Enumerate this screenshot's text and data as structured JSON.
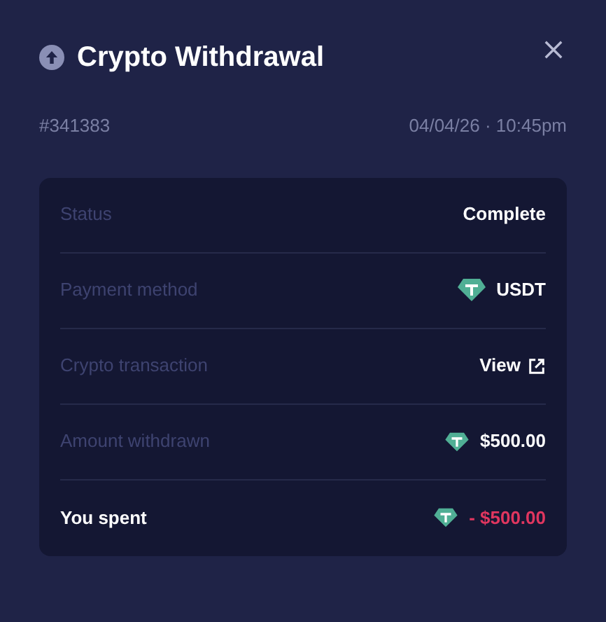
{
  "title": "Crypto Withdrawal",
  "id": "#341383",
  "datetime": "04/04/26 · 10:45pm",
  "rows": [
    {
      "label": "Status",
      "value": "Complete",
      "kind": "text",
      "emphasis": false
    },
    {
      "label": "Payment method",
      "value": "USDT",
      "kind": "token",
      "emphasis": false
    },
    {
      "label": "Crypto transaction",
      "value": "View",
      "kind": "link",
      "emphasis": false
    },
    {
      "label": "Amount withdrawn",
      "value": "$500.00",
      "kind": "token",
      "emphasis": false
    },
    {
      "label": "You spent",
      "value": "- $500.00",
      "kind": "token",
      "emphasis": true
    }
  ]
}
